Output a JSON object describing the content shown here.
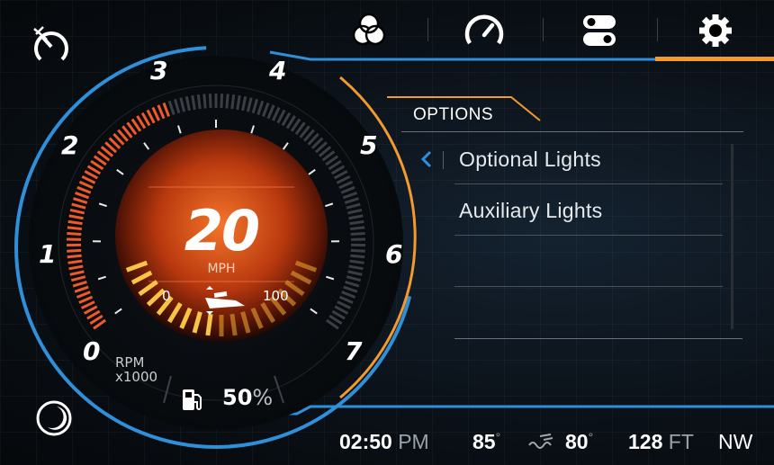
{
  "tachometer": {
    "labels": [
      "0",
      "1",
      "2",
      "3",
      "4",
      "5",
      "6",
      "7"
    ],
    "unit_line1": "RPM",
    "unit_line2": "x1000"
  },
  "speed": {
    "value": "20",
    "unit": "MPH"
  },
  "trim": {
    "min": "0",
    "max": "100"
  },
  "fuel": {
    "value": "50",
    "unit": "%"
  },
  "top_nav": {
    "items": [
      {
        "name": "lighting-tab",
        "icon": "color-circles-icon"
      },
      {
        "name": "gauge-tab",
        "icon": "speedometer-icon"
      },
      {
        "name": "switches-tab",
        "icon": "toggle-switches-icon"
      },
      {
        "name": "settings-tab",
        "icon": "gear-icon",
        "active": true
      }
    ]
  },
  "options": {
    "title": "OPTIONS",
    "items": [
      "Optional Lights",
      "Auxiliary Lights",
      "",
      ""
    ]
  },
  "status_bar": {
    "time": "02:50",
    "ampm": "PM",
    "air_temp": "85",
    "water_temp": "80",
    "depth": "128",
    "depth_unit": "FT",
    "heading": "NW"
  },
  "colors": {
    "accent_orange": "#f29a2e",
    "accent_blue": "#2f8fd8",
    "tach_fill": "#f05a2a"
  }
}
